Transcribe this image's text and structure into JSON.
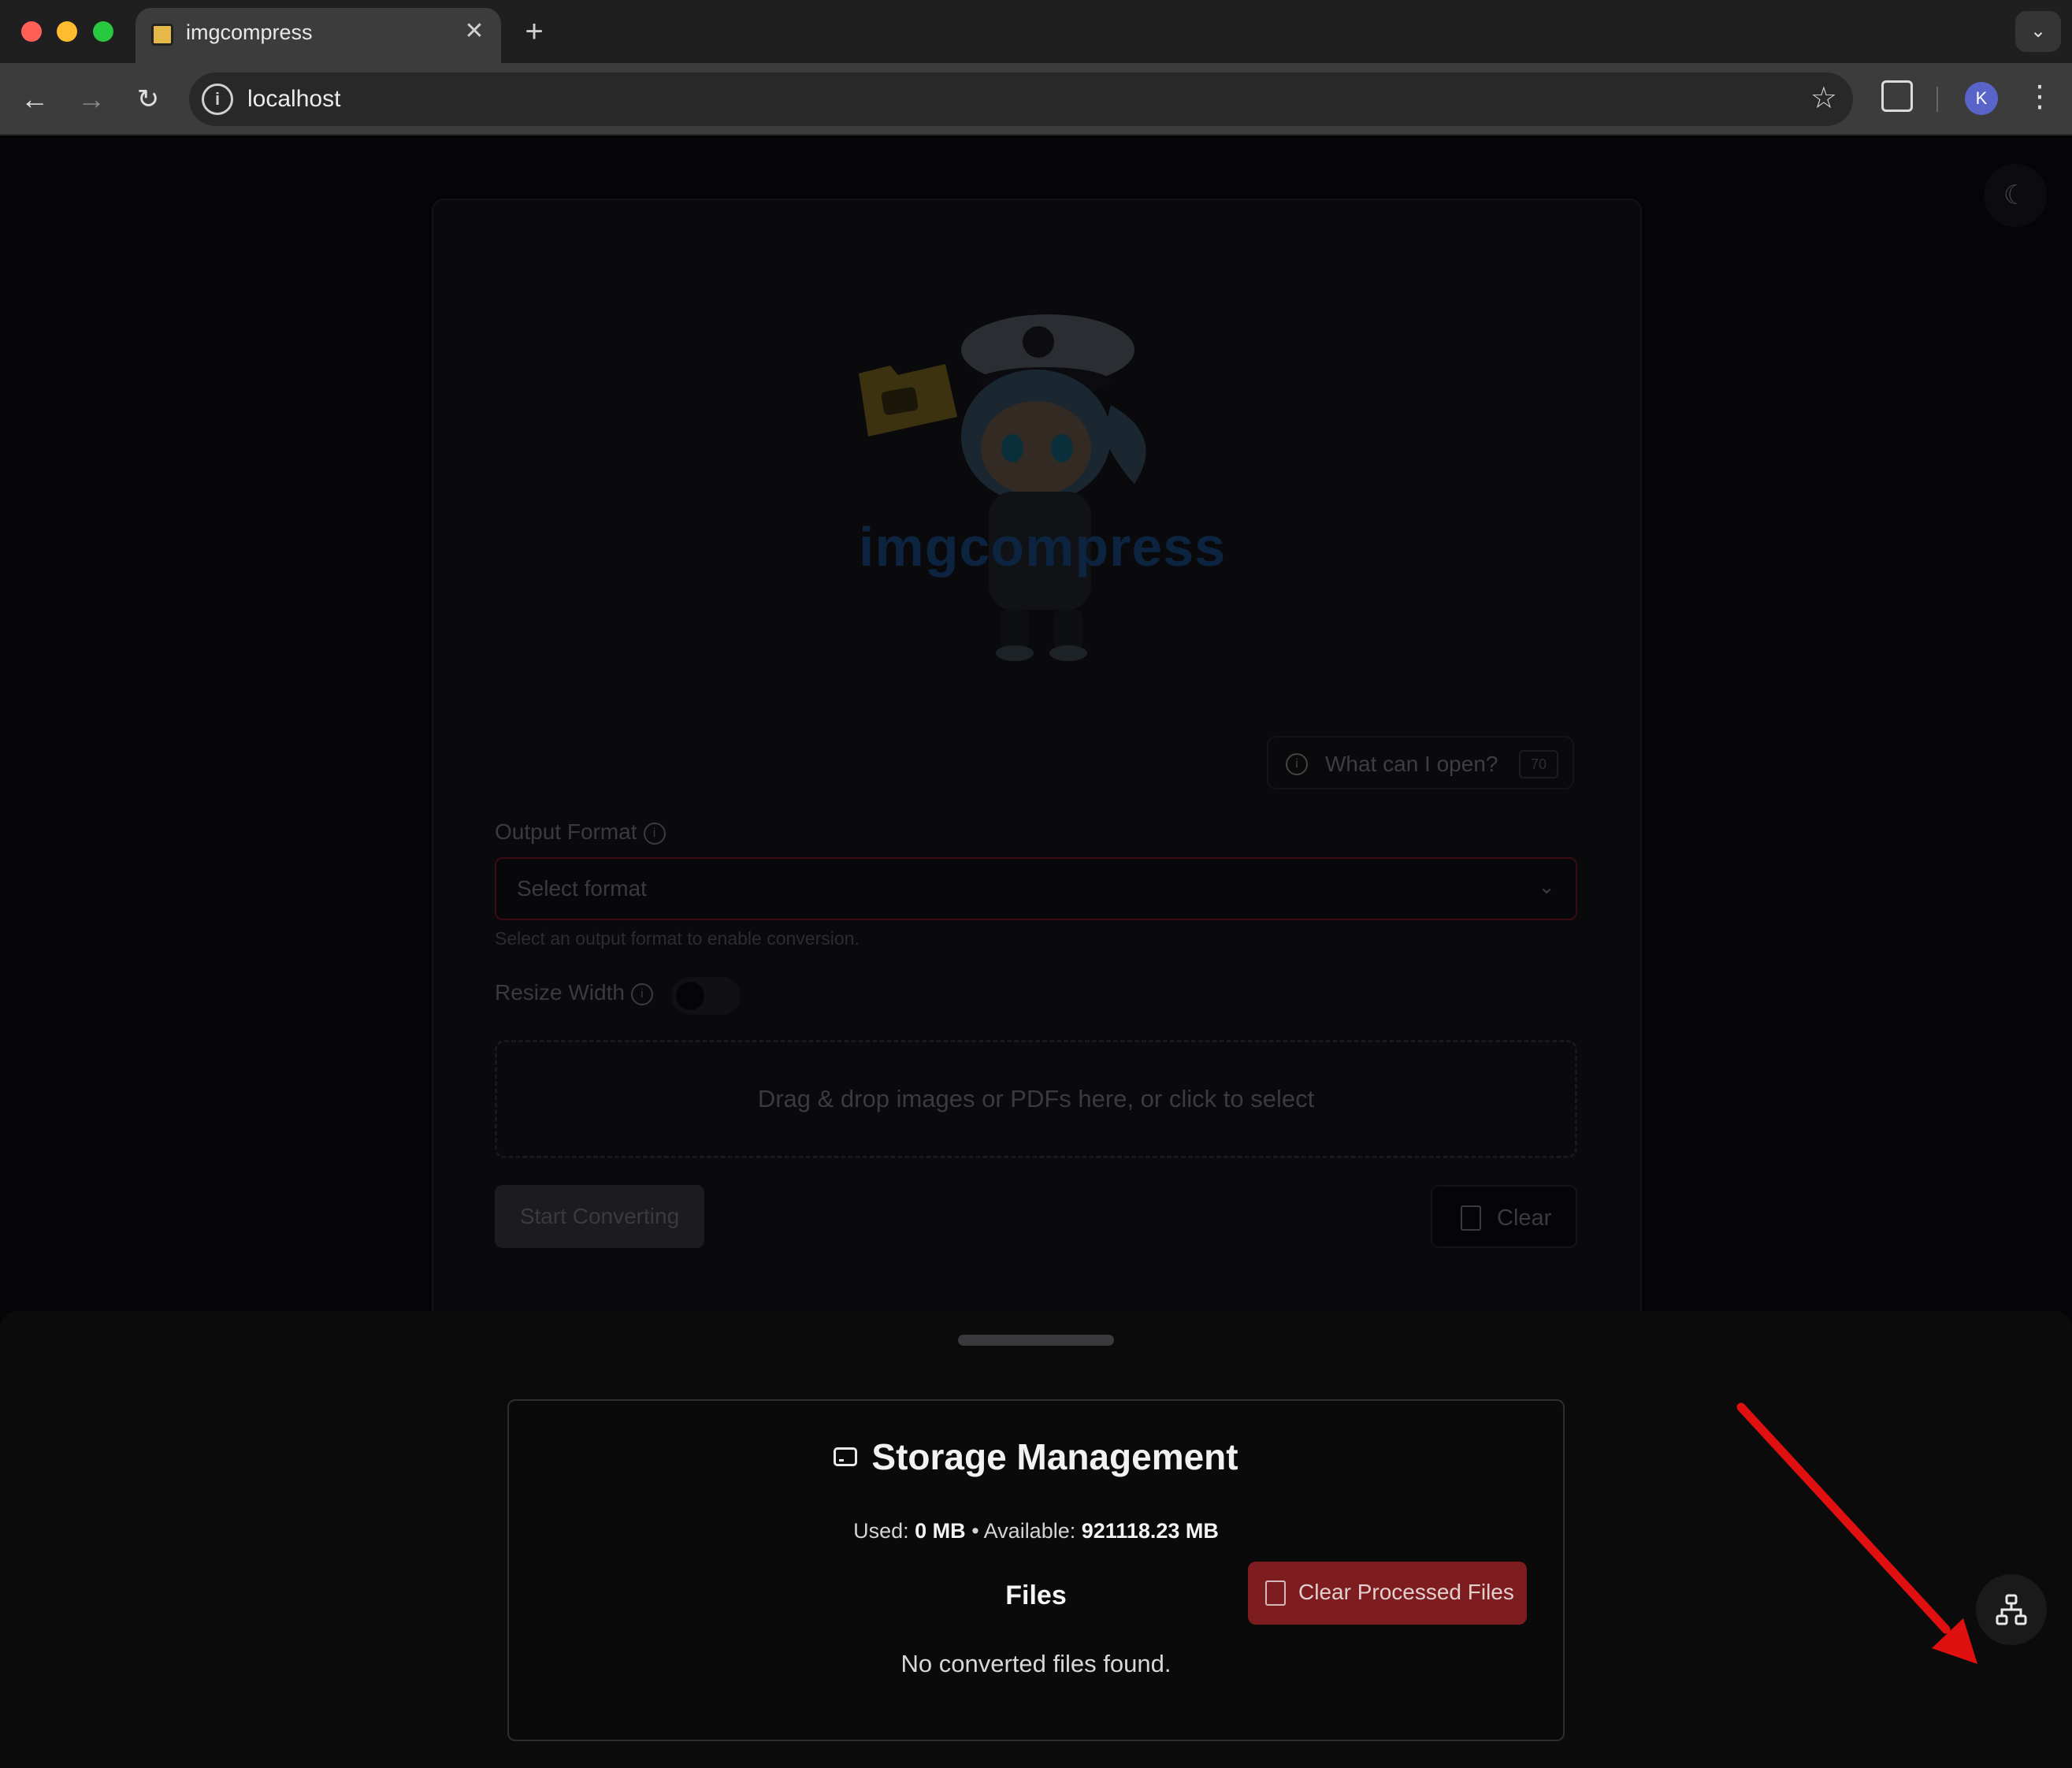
{
  "browser": {
    "tab_title": "imgcompress",
    "tab_close": "✕",
    "new_tab": "+",
    "dropdown": "⌄",
    "url": "localhost",
    "profile_initial": "K"
  },
  "page": {
    "brand": "imgcompress",
    "what_can_i_open": "What can I open?",
    "what_count": "70",
    "output_format_label": "Output Format",
    "select_placeholder": "Select format",
    "select_hint": "Select an output format to enable conversion.",
    "resize_width_label": "Resize Width",
    "dropzone_text": "Drag & drop images or PDFs here, or click to select",
    "start_button": "Start Converting",
    "clear_button": "Clear"
  },
  "storage": {
    "title": "Storage Management",
    "used_label": "Used:",
    "used_value": "0 MB",
    "available_label": "• Available:",
    "available_value": "921118.23 MB",
    "files_heading": "Files",
    "clear_processed": "Clear Processed Files",
    "empty_message": "No converted files found."
  },
  "colors": {
    "annotation_arrow": "#e01010",
    "danger_button": "#7d1d1f",
    "profile": "#5964c9"
  }
}
